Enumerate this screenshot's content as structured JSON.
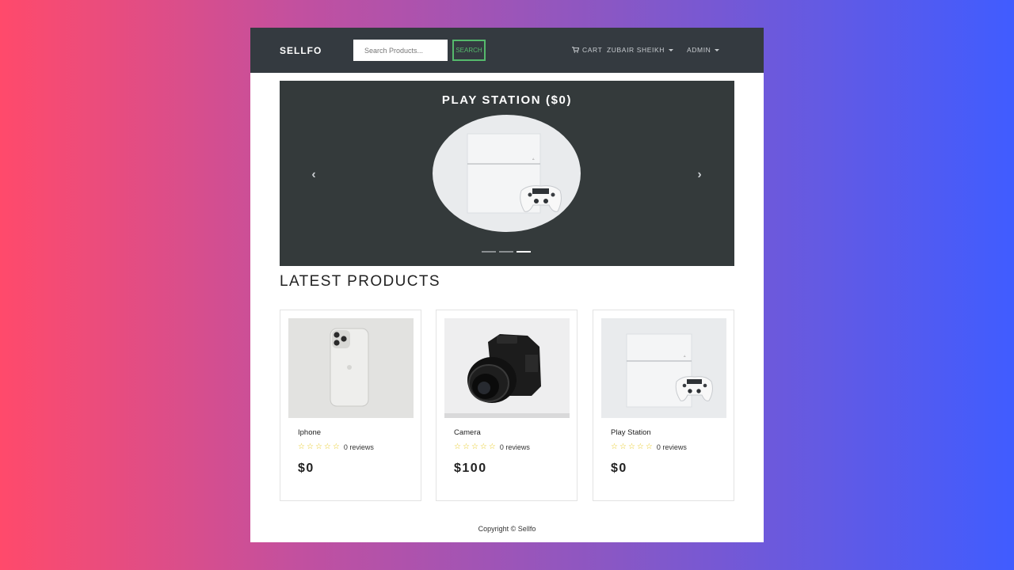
{
  "navbar": {
    "brand": "SELLFO",
    "search_placeholder": "Search Products...",
    "search_button": "SEARCH",
    "cart_label": "CART",
    "user_label": "ZUBAIR SHEIKH",
    "admin_label": "ADMIN"
  },
  "carousel": {
    "title": "PLAY STATION ($0)",
    "prev_glyph": "‹",
    "next_glyph": "›",
    "slide_count": 3,
    "active_slide": 3
  },
  "latest": {
    "title": "LATEST PRODUCTS",
    "products": [
      {
        "name": "Iphone",
        "stars": 0,
        "reviews": "0 reviews",
        "price": "$0",
        "image": "iphone-image"
      },
      {
        "name": "Camera",
        "stars": 0,
        "reviews": "0 reviews",
        "price": "$100",
        "image": "camera-image"
      },
      {
        "name": "Play Station",
        "stars": 0,
        "reviews": "0 reviews",
        "price": "$0",
        "image": "playstation-image"
      }
    ]
  },
  "footer": {
    "text": "Copyright © Sellfo"
  },
  "colors": {
    "navbar_bg": "#343a40",
    "search_accent": "#55b96c",
    "star": "#e8c91f",
    "carousel_bg": "#343a3b"
  }
}
